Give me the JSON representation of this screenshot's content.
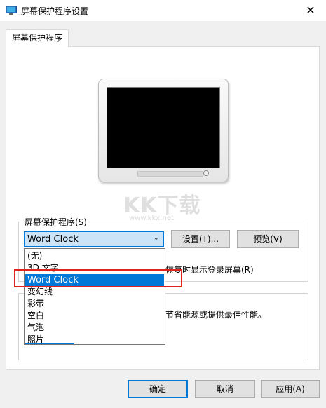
{
  "window": {
    "title": "屏幕保护程序设置",
    "close_glyph": "✕"
  },
  "tabs": [
    {
      "label": "屏幕保护程序"
    }
  ],
  "watermark": {
    "logo": "KK下载",
    "url": "www.kkx.net"
  },
  "screensaver": {
    "group_label": "屏幕保护程序(S)",
    "selected": "Word Clock",
    "settings_button": "设置(T)...",
    "preview_button": "预览(V)",
    "checkbox_label_partial": "恢复时显示登录屏幕(R)",
    "options": [
      "(无)",
      "3D 文字",
      "Word Clock",
      "变幻线",
      "彩带",
      "空白",
      "气泡",
      "照片"
    ]
  },
  "power": {
    "text_partial": "节省能源或提供最佳性能。"
  },
  "footer": {
    "ok": "确定",
    "cancel": "取消",
    "apply": "应用(A)"
  },
  "colors": {
    "accent": "#0078d7",
    "highlight": "#e0231d",
    "combo_bg": "#cce4f7"
  }
}
